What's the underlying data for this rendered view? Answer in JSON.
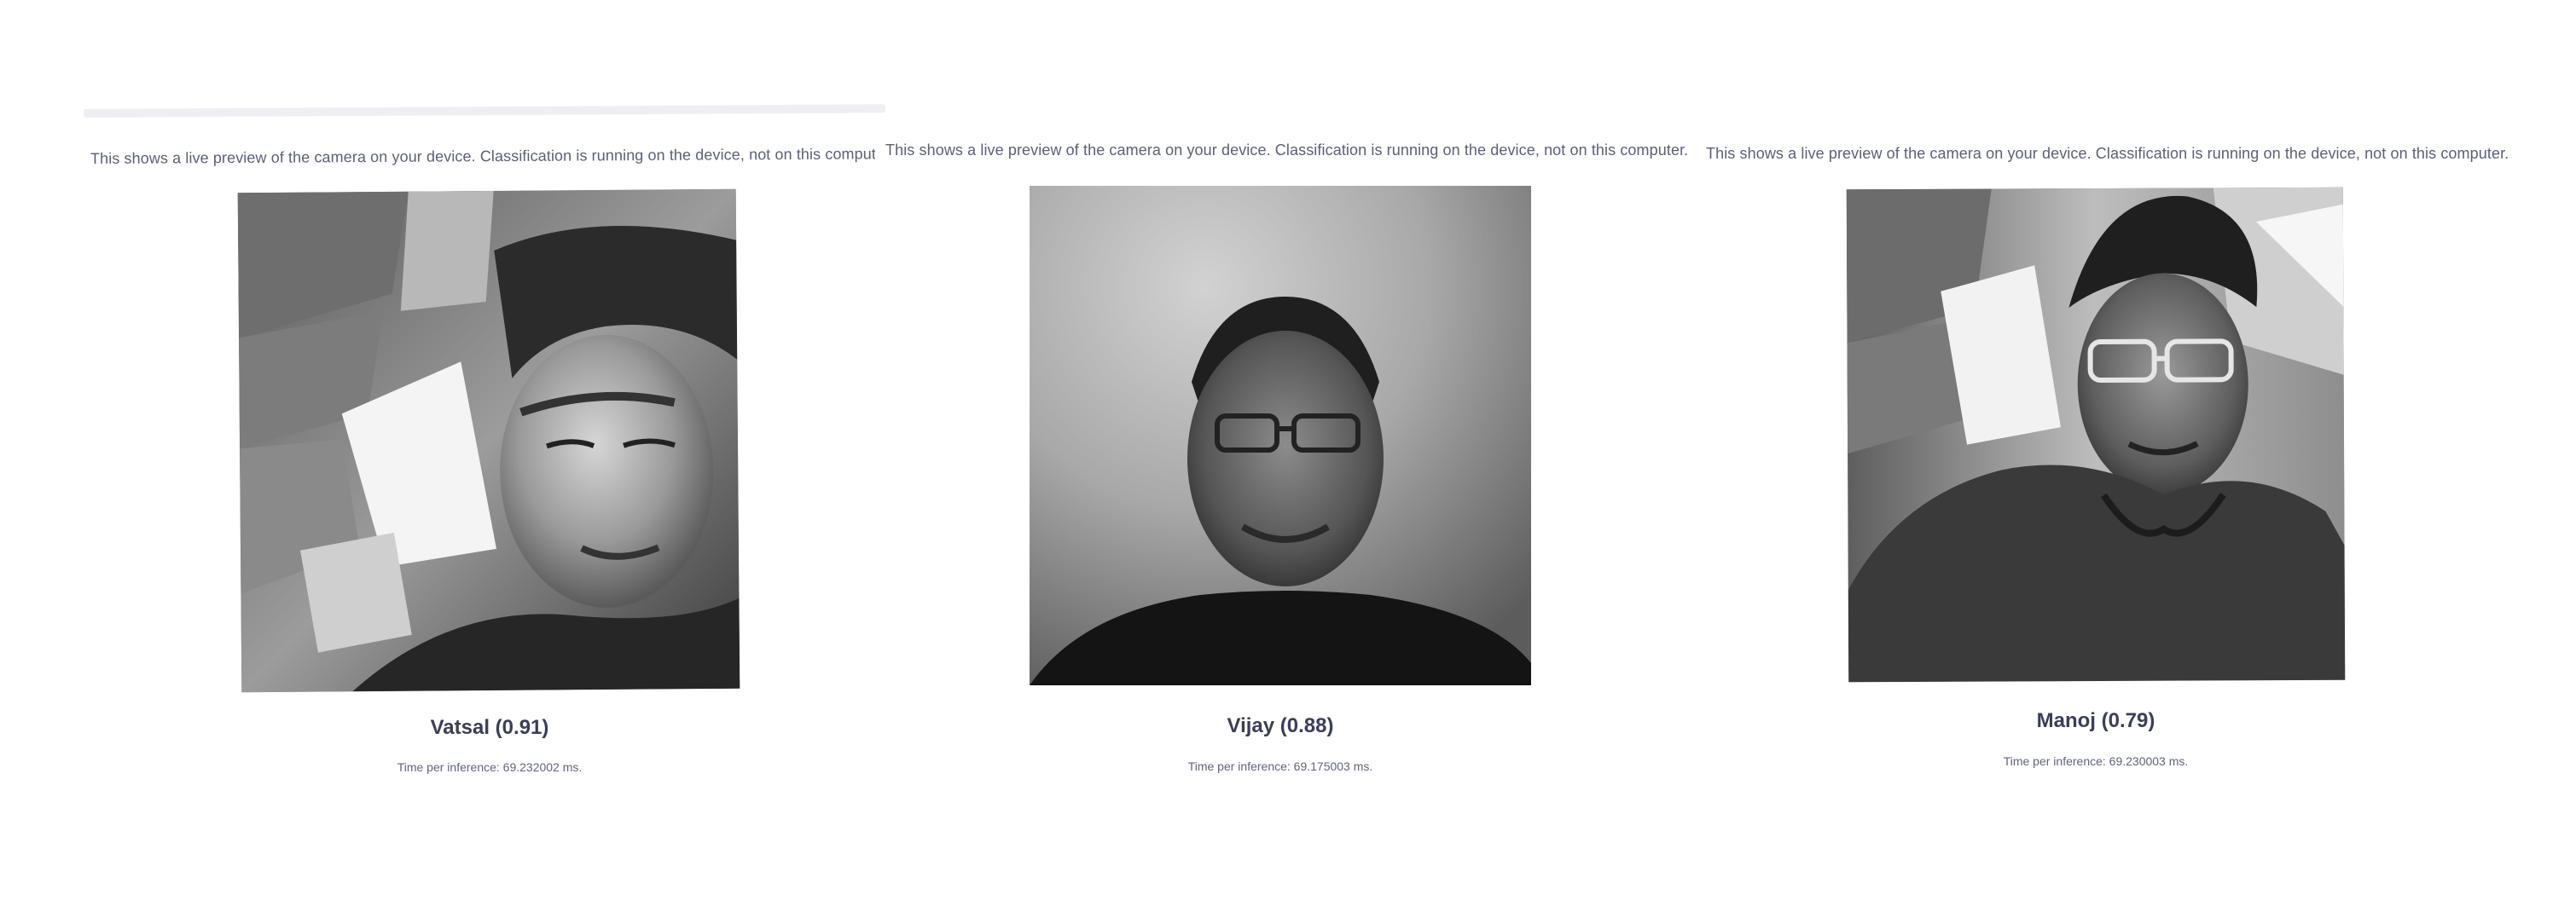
{
  "panels": [
    {
      "notice": "This shows a live preview of the camera on your device. Classification is running on the device, not on this computer.",
      "result": "Vatsal (0.91)",
      "timing": "Time per inference: 69.232002 ms."
    },
    {
      "notice": "This shows a live preview of the camera on your device. Classification is running on the device, not on this computer.",
      "result": "Vijay (0.88)",
      "timing": "Time per inference: 69.175003 ms."
    },
    {
      "notice": "This shows a live preview of the camera on your device. Classification is running on the device, not on this computer.",
      "result": "Manoj (0.79)",
      "timing": "Time per inference: 69.230003 ms."
    }
  ],
  "colors": {
    "text_primary": "#3a3e5a",
    "text_secondary": "#5b6078",
    "divider": "#eeeff2"
  }
}
